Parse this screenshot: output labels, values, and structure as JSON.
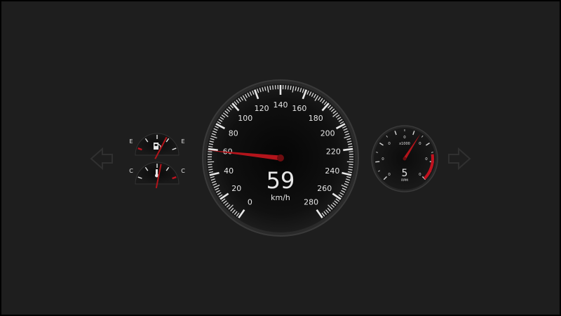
{
  "speedometer": {
    "scale_labels": [
      "0",
      "20",
      "40",
      "60",
      "80",
      "100",
      "120",
      "140",
      "160",
      "180",
      "200",
      "220",
      "240",
      "260",
      "280"
    ],
    "speed_value": "59",
    "speed_unit": "km/h",
    "needle_value": 59,
    "range": [
      0,
      280
    ],
    "needle_color": "#b3141b"
  },
  "fuel_gauge": {
    "left_label": "E",
    "right_label": "E",
    "level_fraction": 0.7,
    "icon": "fuel-pump-icon"
  },
  "temp_gauge": {
    "left_label": "C",
    "right_label": "C",
    "level_fraction": 0.58,
    "icon": "thermometer-icon"
  },
  "tachometer": {
    "scale_labels": [
      "0",
      "0",
      "0",
      "0",
      "0",
      "0",
      "0"
    ],
    "multiplier_label": "x1000",
    "rpm_value": "5",
    "rpm_unit": "RPM",
    "needle_fraction": 0.62,
    "redline_color": "#c1121f"
  },
  "turn_signals": {
    "left_icon": "left-arrow-icon",
    "right_icon": "right-arrow-icon",
    "color": "#2c2c2c"
  }
}
